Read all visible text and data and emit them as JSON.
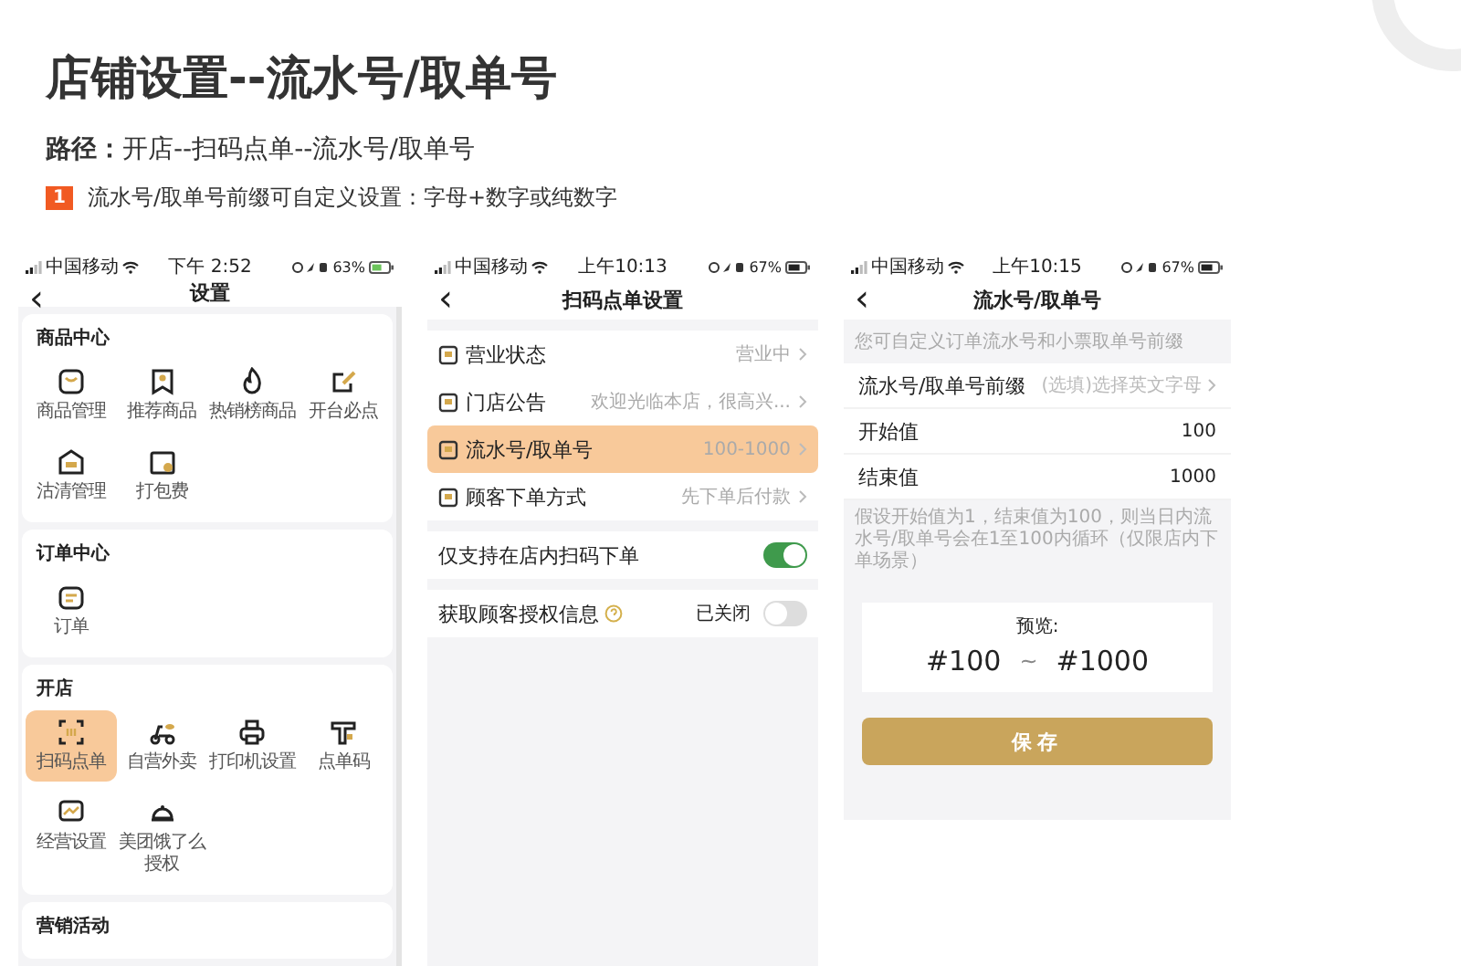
{
  "title": "店铺设置--流水号/取单号",
  "path": "**路径：**开店--扫码点单--流水号/取单号",
  "note": {
    "badge": "1",
    "text": "流水号/取单号前缀可自定义设置：字母+数字或纯数字"
  },
  "phones": [
    {
      "kind": "settings",
      "status": {
        "carrier": "中国移动",
        "time": "下午 2:52",
        "battery": "63%"
      },
      "title": "设置",
      "back": "‹",
      "sections": [
        {
          "title": "商品中心",
          "items": [
            {
              "label": "商品管理",
              "selected": false
            },
            {
              "label": "推荐商品",
              "selected": false
            },
            {
              "label": "热销榜商品",
              "selected": false
            },
            {
              "label": "开台必点",
              "selected": false
            },
            {
              "label": "沽清管理",
              "selected": false
            },
            {
              "label": "打包费",
              "selected": false
            }
          ]
        },
        {
          "title": "订单中心",
          "items": [
            {
              "label": "订单",
              "selected": false
            }
          ]
        },
        {
          "title": "开店",
          "items": [
            {
              "label": "扫码点单",
              "selected": true
            },
            {
              "label": "自营外卖",
              "selected": false
            },
            {
              "label": "打印机设置",
              "selected": false
            },
            {
              "label": "点单码",
              "selected": false
            },
            {
              "label": "经营设置",
              "selected": false
            },
            {
              "label": "美团饿了么授权",
              "selected": false
            }
          ]
        },
        {
          "title": "营销活动"
        }
      ]
    },
    {
      "kind": "list",
      "status": {
        "carrier": "中国移动",
        "time": "上午10:13",
        "battery": "67%"
      },
      "title": "扫码点单设置",
      "back": "‹",
      "rows": [
        {
          "label": "营业状态",
          "value": "营业中",
          "selected": false
        },
        {
          "label": "门店公告",
          "value": "欢迎光临本店，很高兴...",
          "selected": false
        },
        {
          "label": "流水号/取单号",
          "value": "100-1000",
          "selected": true
        },
        {
          "label": "顾客下单方式",
          "value": "先下单后付款",
          "selected": false
        }
      ],
      "toggles": [
        {
          "label": "仅支持在店内扫码下单",
          "on": true,
          "help": false
        },
        {
          "label": "获取顾客授权信息",
          "on": false,
          "help": true,
          "state": "已关闭"
        }
      ]
    },
    {
      "kind": "form",
      "status": {
        "carrier": "中国移动",
        "time": "上午10:15",
        "battery": "67%"
      },
      "title": "流水号/取单号",
      "back": "‹",
      "hint": "您可自定义订单流水号和小票取单号前缀",
      "prefix": {
        "label": "流水号/取单号前缀",
        "placeholder": "(选填)选择英文字母"
      },
      "fields": [
        {
          "label": "开始值",
          "value": "100"
        },
        {
          "label": "结束值",
          "value": "1000"
        }
      ],
      "footnote": "假设开始值为1，结束值为100，则当日内流水号/取单号会在1至100内循环（仅限店内下单场景）",
      "preview": {
        "label": "预览:",
        "start": "#100",
        "separator": "~",
        "end": "#1000"
      },
      "button": "保存"
    }
  ]
}
